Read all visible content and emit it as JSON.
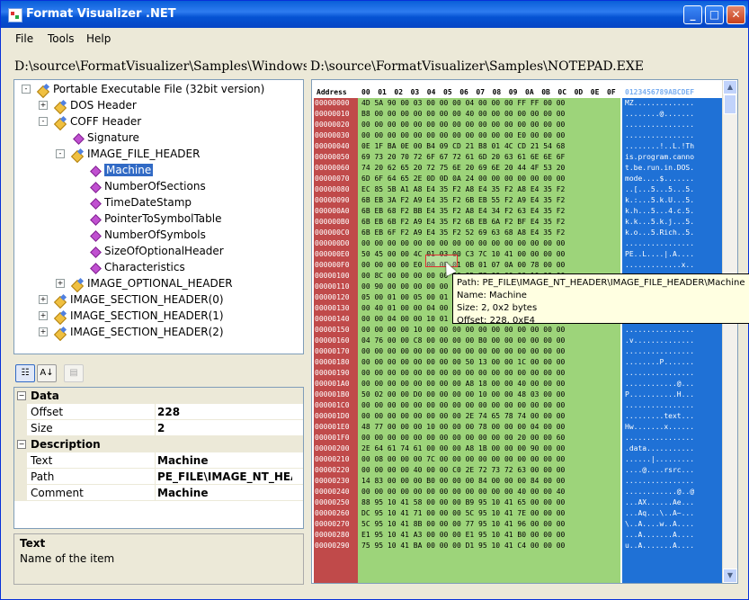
{
  "window": {
    "title": "Format Visualizer .NET"
  },
  "menu": [
    "File",
    "Tools",
    "Help"
  ],
  "paths": {
    "left": "D:\\source\\FormatVisualizer\\Samples\\Windows PE",
    "right": "D:\\source\\FormatVisualizer\\Samples\\NOTEPAD.EXE"
  },
  "tree": [
    {
      "label": "Portable Executable File (32bit version)",
      "depth": 0,
      "exp": "-",
      "icon": "folder"
    },
    {
      "label": "DOS Header",
      "depth": 1,
      "exp": "+",
      "icon": "folder"
    },
    {
      "label": "COFF Header",
      "depth": 1,
      "exp": "-",
      "icon": "folder"
    },
    {
      "label": "Signature",
      "depth": 2,
      "exp": "",
      "icon": "leaf"
    },
    {
      "label": "IMAGE_FILE_HEADER",
      "depth": 2,
      "exp": "-",
      "icon": "folder"
    },
    {
      "label": "Machine",
      "depth": 3,
      "exp": "",
      "icon": "leaf",
      "selected": true
    },
    {
      "label": "NumberOfSections",
      "depth": 3,
      "exp": "",
      "icon": "leaf"
    },
    {
      "label": "TimeDateStamp",
      "depth": 3,
      "exp": "",
      "icon": "leaf"
    },
    {
      "label": "PointerToSymbolTable",
      "depth": 3,
      "exp": "",
      "icon": "leaf"
    },
    {
      "label": "NumberOfSymbols",
      "depth": 3,
      "exp": "",
      "icon": "leaf"
    },
    {
      "label": "SizeOfOptionalHeader",
      "depth": 3,
      "exp": "",
      "icon": "leaf"
    },
    {
      "label": "Characteristics",
      "depth": 3,
      "exp": "",
      "icon": "leaf"
    },
    {
      "label": "IMAGE_OPTIONAL_HEADER",
      "depth": 2,
      "exp": "+",
      "icon": "folder"
    },
    {
      "label": "IMAGE_SECTION_HEADER(0)",
      "depth": 1,
      "exp": "+",
      "icon": "folder"
    },
    {
      "label": "IMAGE_SECTION_HEADER(1)",
      "depth": 1,
      "exp": "+",
      "icon": "folder"
    },
    {
      "label": "IMAGE_SECTION_HEADER(2)",
      "depth": 1,
      "exp": "+",
      "icon": "folder"
    }
  ],
  "props": {
    "data_cat": "Data",
    "offset_key": "Offset",
    "offset_val": "228",
    "size_key": "Size",
    "size_val": "2",
    "desc_cat": "Description",
    "text_key": "Text",
    "text_val": "Machine",
    "path_key": "Path",
    "path_val": "PE_FILE\\IMAGE_NT_HEADER\\IMAGE_FILE_HEADER\\Machine",
    "comment_key": "Comment",
    "comment_val": "Machine"
  },
  "description": {
    "title": "Text",
    "body": "Name of the item"
  },
  "hex": {
    "addr_header": "Address",
    "col_headers": [
      "00",
      "01",
      "02",
      "03",
      "04",
      "05",
      "06",
      "07",
      "08",
      "09",
      "0A",
      "0B",
      "0C",
      "0D",
      "0E",
      "0F"
    ],
    "ascii_header": "0123456789ABCDEF",
    "rows": [
      [
        "00000000",
        "4D 5A 90 00 03 00 00 00 04 00 00 00 FF FF 00 00",
        "MZ.............."
      ],
      [
        "00000010",
        "B8 00 00 00 00 00 00 00 40 00 00 00 00 00 00 00",
        "........@......."
      ],
      [
        "00000020",
        "00 00 00 00 00 00 00 00 00 00 00 00 00 00 00 00",
        "................"
      ],
      [
        "00000030",
        "00 00 00 00 00 00 00 00 00 00 00 00 E0 00 00 00",
        "................"
      ],
      [
        "00000040",
        "0E 1F BA 0E 00 B4 09 CD 21 B8 01 4C CD 21 54 68",
        "........!..L.!Th"
      ],
      [
        "00000050",
        "69 73 20 70 72 6F 67 72 61 6D 20 63 61 6E 6E 6F",
        "is.program.canno"
      ],
      [
        "00000060",
        "74 20 62 65 20 72 75 6E 20 69 6E 20 44 4F 53 20",
        "t.be.run.in.DOS."
      ],
      [
        "00000070",
        "6D 6F 64 65 2E 0D 0D 0A 24 00 00 00 00 00 00 00",
        "mode....$......."
      ],
      [
        "00000080",
        "EC 85 5B A1 A8 E4 35 F2 A8 E4 35 F2 A8 E4 35 F2",
        "..[...5...5...5."
      ],
      [
        "00000090",
        "6B EB 3A F2 A9 E4 35 F2 6B EB 55 F2 A9 E4 35 F2",
        "k.:...5.k.U...5."
      ],
      [
        "000000A0",
        "6B EB 68 F2 BB E4 35 F2 A8 E4 34 F2 63 E4 35 F2",
        "k.h...5...4.c.5."
      ],
      [
        "000000B0",
        "6B EB 6B F2 A9 E4 35 F2 6B EB 6A F2 BF E4 35 F2",
        "k.k...5.k.j...5."
      ],
      [
        "000000C0",
        "6B EB 6F F2 A9 E4 35 F2 52 69 63 68 A8 E4 35 F2",
        "k.o...5.Rich..5."
      ],
      [
        "000000D0",
        "00 00 00 00 00 00 00 00 00 00 00 00 00 00 00 00",
        "................"
      ],
      [
        "000000E0",
        "50 45 00 00 4C 01 03 00 C3 7C 10 41 00 00 00 00",
        "PE..L....|.A...."
      ],
      [
        "000000F0",
        "00 00 00 00 E0 00 0F 01 0B 01 07 0A 00 78 00 00",
        ".............x.."
      ],
      [
        "00000100",
        "00 8C 00 00 00 00 00 00 9D 73 00 00 00 10 00 00",
        ".........s......"
      ],
      [
        "00000110",
        "00 90 00 00 00 00 00 01 00 10 00 00 00 02 00 00",
        "................"
      ],
      [
        "00000120",
        "05 00 01 00 05 00 01 00 04 00 00 00 00 00 00 00",
        "................"
      ],
      [
        "00000130",
        "00 40 01 00 00 04 00 00 FC D7 01 00 02 00 00 80",
        ".@.............."
      ],
      [
        "00000140",
        "00 00 04 00 00 10 01 00 00 00 10 00 00 10 00 00",
        "................"
      ],
      [
        "00000150",
        "00 00 00 00 10 00 00 00 00 00 00 00 00 00 00 00",
        "................"
      ],
      [
        "00000160",
        "04 76 00 00 C8 00 00 00 00 B0 00 00 00 00 00 00",
        ".v.............."
      ],
      [
        "00000170",
        "00 00 00 00 00 00 00 00 00 00 00 00 00 00 00 00",
        "................"
      ],
      [
        "00000180",
        "00 00 00 00 00 00 00 00 50 13 00 00 1C 00 00 00",
        "........P......."
      ],
      [
        "00000190",
        "00 00 00 00 00 00 00 00 00 00 00 00 00 00 00 00",
        "................"
      ],
      [
        "000001A0",
        "00 00 00 00 00 00 00 00 A8 18 00 00 40 00 00 00",
        "............@..."
      ],
      [
        "000001B0",
        "50 02 00 00 D0 00 00 00 00 10 00 00 48 03 00 00",
        "P...........H..."
      ],
      [
        "000001C0",
        "00 00 00 00 00 00 00 00 00 00 00 00 00 00 00 00",
        "................"
      ],
      [
        "000001D0",
        "00 00 00 00 00 00 00 00 2E 74 65 78 74 00 00 00",
        ".........text..."
      ],
      [
        "000001E0",
        "48 77 00 00 00 10 00 00 00 78 00 00 00 04 00 00",
        "Hw.......x......"
      ],
      [
        "000001F0",
        "00 00 00 00 00 00 00 00 00 00 00 00 20 00 00 60",
        "................"
      ],
      [
        "00000200",
        "2E 64 61 74 61 00 00 00 A8 1B 00 00 00 90 00 00",
        ".data..........."
      ],
      [
        "00000210",
        "00 08 00 00 00 7C 00 00 00 00 00 00 00 00 00 00",
        "......|........."
      ],
      [
        "00000220",
        "00 00 00 00 40 00 00 C0 2E 72 73 72 63 00 00 00",
        "....@....rsrc..."
      ],
      [
        "00000230",
        "14 83 00 00 00 B0 00 00 00 84 00 00 00 84 00 00",
        "................"
      ],
      [
        "00000240",
        "00 00 00 00 00 00 00 00 00 00 00 00 40 00 00 40",
        "............@..@"
      ],
      [
        "00000250",
        "88 95 10 41 58 00 00 00 B9 95 10 41 65 00 00 00",
        "...AX......Ae..."
      ],
      [
        "00000260",
        "DC 95 10 41 71 00 00 00 5C 95 10 41 7E 00 00 00",
        "...Aq...\\..A~..."
      ],
      [
        "00000270",
        "5C 95 10 41 8B 00 00 00 77 95 10 41 96 00 00 00",
        "\\..A....w..A...."
      ],
      [
        "00000280",
        "E1 95 10 41 A3 00 00 00 E1 95 10 41 B0 00 00 00",
        "...A.......A...."
      ],
      [
        "00000290",
        "75 95 10 41 BA 00 00 00 D1 95 10 41 C4 00 00 00",
        "u..A.......A...."
      ]
    ]
  },
  "tooltip": {
    "line1": "Path: PE_FILE\\IMAGE_NT_HEADER\\IMAGE_FILE_HEADER\\Machine",
    "line2": "Name: Machine",
    "line3": "Size: 2, 0x2 bytes",
    "line4": "Offset: 228, 0xE4"
  },
  "colors": {
    "addr_bg": "#C04A4A",
    "bytes_bg": "#9DD47A",
    "ascii_bg": "#1F71D6",
    "selection": "#316AC5"
  }
}
